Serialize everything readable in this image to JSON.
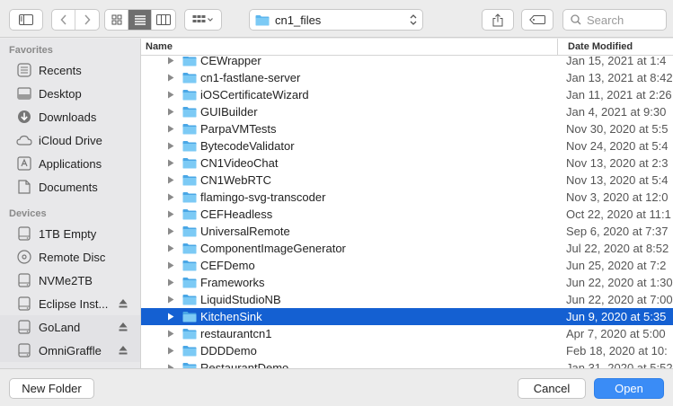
{
  "toolbar": {
    "path_label": "cn1_files",
    "search_placeholder": "Search"
  },
  "sidebar": {
    "favorites_heading": "Favorites",
    "favorites": [
      {
        "label": "Recents",
        "icon": "clock-icon"
      },
      {
        "label": "Desktop",
        "icon": "desktop-icon"
      },
      {
        "label": "Downloads",
        "icon": "download-icon"
      },
      {
        "label": "iCloud Drive",
        "icon": "cloud-icon"
      },
      {
        "label": "Applications",
        "icon": "applications-icon"
      },
      {
        "label": "Documents",
        "icon": "document-icon"
      }
    ],
    "devices_heading": "Devices",
    "devices": [
      {
        "label": "1TB Empty",
        "icon": "disk-icon"
      },
      {
        "label": "Remote Disc",
        "icon": "disc-icon"
      },
      {
        "label": "NVMe2TB",
        "icon": "disk-icon"
      },
      {
        "label": "Eclipse Inst...",
        "icon": "disk-icon"
      },
      {
        "label": "GoLand",
        "icon": "disk-icon"
      },
      {
        "label": "OmniGraffle",
        "icon": "disk-icon"
      }
    ]
  },
  "list": {
    "header_name": "Name",
    "header_date": "Date Modified",
    "rows": [
      {
        "name": "CEWrapper",
        "date": "Jan 15, 2021 at 1:4"
      },
      {
        "name": "cn1-fastlane-server",
        "date": "Jan 13, 2021 at 8:42"
      },
      {
        "name": "iOSCertificateWizard",
        "date": "Jan 11, 2021 at 2:26"
      },
      {
        "name": "GUIBuilder",
        "date": "Jan 4, 2021 at 9:30"
      },
      {
        "name": "ParpaVMTests",
        "date": "Nov 30, 2020 at 5:5"
      },
      {
        "name": "BytecodeValidator",
        "date": "Nov 24, 2020 at 5:4"
      },
      {
        "name": "CN1VideoChat",
        "date": "Nov 13, 2020 at 2:3"
      },
      {
        "name": "CN1WebRTC",
        "date": "Nov 13, 2020 at 5:4"
      },
      {
        "name": "flamingo-svg-transcoder",
        "date": "Nov 3, 2020 at 12:0"
      },
      {
        "name": "CEFHeadless",
        "date": "Oct 22, 2020 at 11:1"
      },
      {
        "name": "UniversalRemote",
        "date": "Sep 6, 2020 at 7:37"
      },
      {
        "name": "ComponentImageGenerator",
        "date": "Jul 22, 2020 at 8:52"
      },
      {
        "name": "CEFDemo",
        "date": "Jun 25, 2020 at 7:2"
      },
      {
        "name": "Frameworks",
        "date": "Jun 22, 2020 at 1:30"
      },
      {
        "name": "LiquidStudioNB",
        "date": "Jun 22, 2020 at 7:00"
      },
      {
        "name": "KitchenSink",
        "date": "Jun 9, 2020 at 5:35"
      },
      {
        "name": "restaurantcn1",
        "date": "Apr 7, 2020 at 5:00"
      },
      {
        "name": "DDDDemo",
        "date": "Feb 18, 2020 at 10:"
      },
      {
        "name": "RestaurantDemo",
        "date": "Jan 31, 2020 at 5:52"
      }
    ],
    "selected_index": 15
  },
  "buttons": {
    "new_folder": "New Folder",
    "cancel": "Cancel",
    "open": "Open"
  },
  "colors": {
    "selection": "#1460d2",
    "primary_button": "#3a8cf6",
    "folder": "#5cb6ee"
  }
}
